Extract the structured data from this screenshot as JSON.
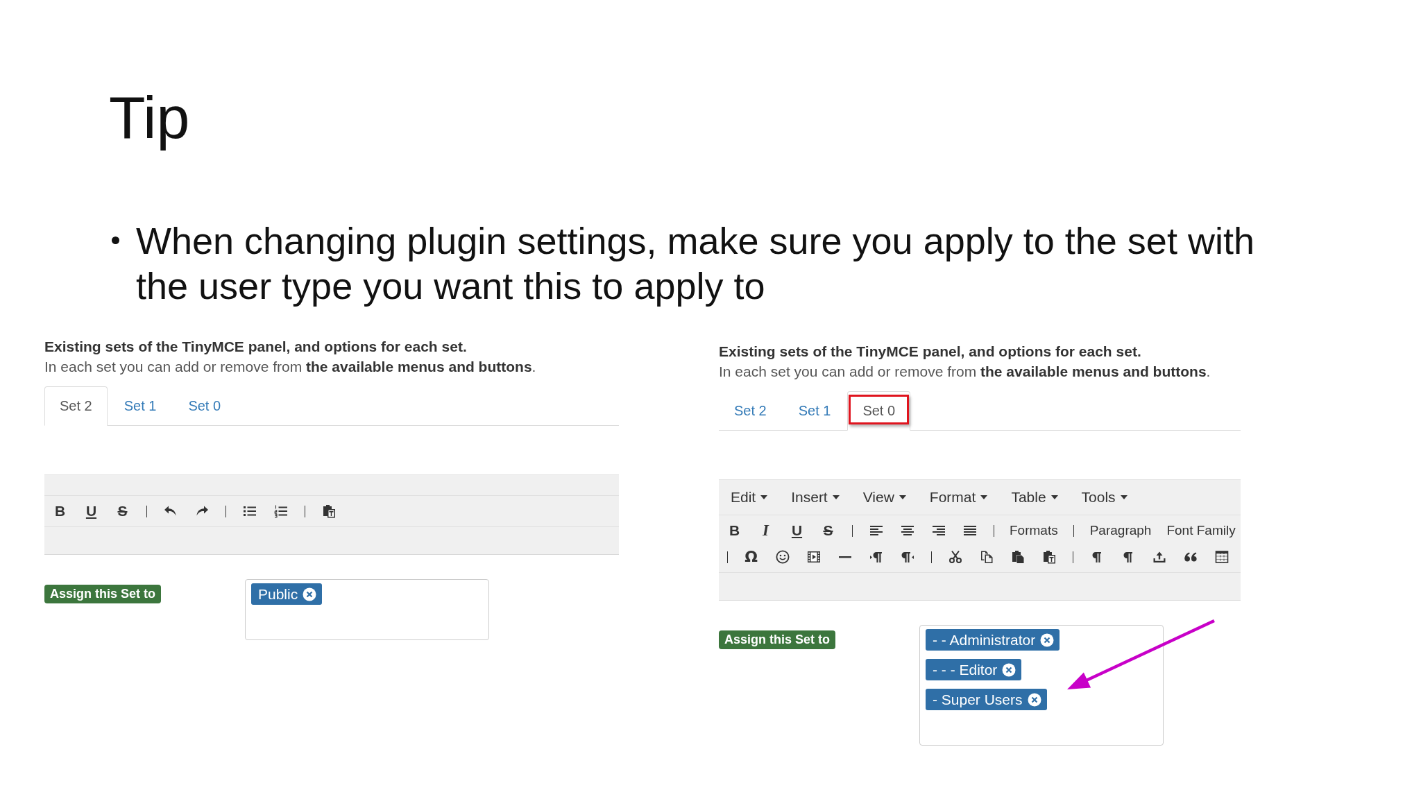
{
  "slide": {
    "title": "Tip",
    "bullets": [
      "When changing plugin settings, make sure you apply to the set with the user type you want this to apply to"
    ]
  },
  "screenshots": [
    {
      "heading": "Existing sets of the TinyMCE panel, and options for each set.",
      "description": "In each set you can add or remove from **the available menus and buttons**.",
      "tabs": [
        {
          "label": "Set 2",
          "selected": true,
          "highlighted": false
        },
        {
          "label": "Set 1",
          "selected": false,
          "highlighted": false
        },
        {
          "label": "Set 0",
          "selected": false,
          "highlighted": false
        }
      ],
      "toolbar_rows": [
        [
          {
            "kind": "bold",
            "text": "B"
          },
          {
            "kind": "underline",
            "text": "U"
          },
          {
            "kind": "strike",
            "text": "S"
          },
          {
            "kind": "separator"
          },
          {
            "kind": "icon"
          },
          {
            "kind": "icon"
          },
          {
            "kind": "separator"
          },
          {
            "kind": "icon"
          },
          {
            "kind": "icon"
          },
          {
            "kind": "separator"
          },
          {
            "kind": "icon"
          }
        ]
      ],
      "assign_label": "Assign this Set to",
      "assigned": [
        "Public"
      ]
    },
    {
      "heading": "Existing sets of the TinyMCE panel, and options for each set.",
      "description": "In each set you can add or remove from **the available menus and buttons**.",
      "tabs": [
        {
          "label": "Set 2",
          "selected": false,
          "highlighted": false
        },
        {
          "label": "Set 1",
          "selected": false,
          "highlighted": false
        },
        {
          "label": "Set 0",
          "selected": true,
          "highlighted": true
        }
      ],
      "menus": [
        "Edit",
        "Insert",
        "View",
        "Format",
        "Table",
        "Tools"
      ],
      "toolbar_rows": [
        [
          {
            "kind": "bold",
            "text": "B"
          },
          {
            "kind": "italic",
            "text": "I"
          },
          {
            "kind": "underline",
            "text": "U"
          },
          {
            "kind": "strike",
            "text": "S"
          },
          {
            "kind": "separator"
          },
          {
            "kind": "icon"
          },
          {
            "kind": "icon"
          },
          {
            "kind": "icon"
          },
          {
            "kind": "icon"
          },
          {
            "kind": "separator"
          },
          {
            "kind": "label",
            "text": "Formats"
          },
          {
            "kind": "separator"
          },
          {
            "kind": "label",
            "text": "Paragraph"
          },
          {
            "kind": "label",
            "text": "Font Family"
          }
        ],
        [
          {
            "kind": "separator"
          },
          {
            "kind": "glyph",
            "text": "Ω"
          },
          {
            "kind": "icon"
          },
          {
            "kind": "icon"
          },
          {
            "kind": "icon"
          },
          {
            "kind": "icon"
          },
          {
            "kind": "icon"
          },
          {
            "kind": "separator"
          },
          {
            "kind": "icon"
          },
          {
            "kind": "icon"
          },
          {
            "kind": "icon"
          },
          {
            "kind": "icon"
          },
          {
            "kind": "separator"
          },
          {
            "kind": "icon"
          },
          {
            "kind": "icon"
          },
          {
            "kind": "icon"
          },
          {
            "kind": "icon"
          },
          {
            "kind": "icon"
          }
        ]
      ],
      "assign_label": "Assign this Set to",
      "assigned": [
        "- - Administrator",
        "- - - Editor",
        "- Super Users"
      ],
      "arrow": true
    }
  ]
}
